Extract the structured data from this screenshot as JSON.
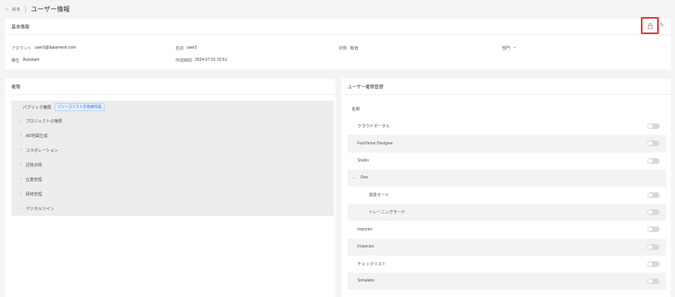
{
  "header": {
    "back_label": "戻る",
    "title": "ユーザー情報"
  },
  "basic": {
    "title": "基本情報",
    "account_label": "アカウント",
    "account": "user3@datamesh.com",
    "name_label": "名前",
    "name": "user2",
    "status_label": "状態",
    "status": "有効",
    "dept_label": "部門",
    "dept": "--",
    "position_label": "職位",
    "position": "Assistant",
    "created_label": "作成時間",
    "created": "2024-07-01 15:51"
  },
  "permissions": {
    "title": "権限",
    "public_label": "パブリック権限",
    "create_resource_list": "リソースリストを新規作成",
    "items": [
      "プロジェクトの権限",
      "AR地図生成",
      "コラボレーション",
      "記憶点検",
      "企業管理",
      "研修管理",
      "デジタルツイン"
    ]
  },
  "user_permissions": {
    "title": "ユーザー権限管理",
    "name_header": "名称",
    "rows": [
      {
        "label": "クラウドポータル",
        "kind": "item"
      },
      {
        "label": "FactVerse Designer",
        "kind": "item"
      },
      {
        "label": "Studio",
        "kind": "item"
      },
      {
        "label": "One",
        "kind": "group"
      },
      {
        "label": "標準モード",
        "kind": "child"
      },
      {
        "label": "トレーニングモード",
        "kind": "child"
      },
      {
        "label": "Importer",
        "kind": "item"
      },
      {
        "label": "Inspector",
        "kind": "item"
      },
      {
        "label": "チェックリスト",
        "kind": "item"
      },
      {
        "label": "Simulator",
        "kind": "item"
      }
    ]
  },
  "icons": {
    "lock": "lock-icon",
    "edit": "pencil-icon"
  },
  "colors": {
    "highlight": "#e53935",
    "accent": "#2f6fcd"
  }
}
